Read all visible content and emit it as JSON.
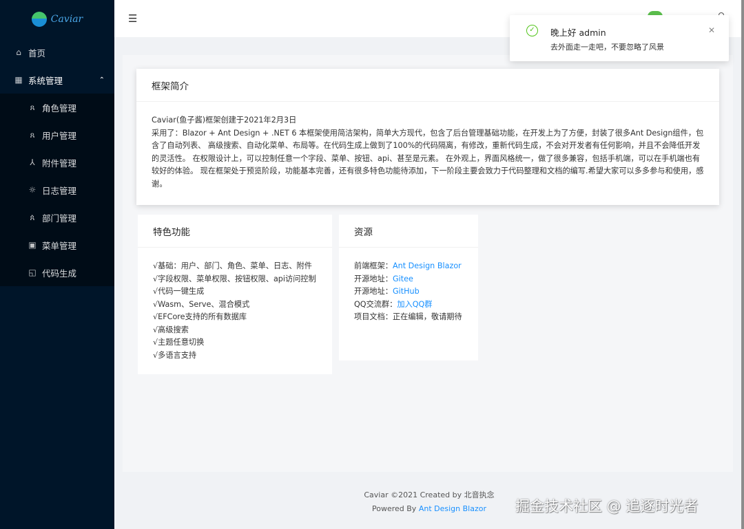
{
  "app": {
    "logo_text": "Caviar"
  },
  "sidebar": {
    "home": {
      "icon": "home-icon",
      "label": "首页"
    },
    "system": {
      "icon": "appstore-icon",
      "label": "系统管理"
    },
    "items": [
      {
        "icon": "user-icon",
        "label": "角色管理"
      },
      {
        "icon": "user-icon",
        "label": "用户管理"
      },
      {
        "icon": "cluster-icon",
        "label": "附件管理"
      },
      {
        "icon": "bug-icon",
        "label": "日志管理"
      },
      {
        "icon": "team-icon",
        "label": "部门管理"
      },
      {
        "icon": "menu-icon",
        "label": "菜单管理"
      },
      {
        "icon": "code-icon",
        "label": "代码生成"
      }
    ]
  },
  "header": {
    "fold_icon": "menu-fold-icon"
  },
  "intro": {
    "title": "框架简介",
    "line1": "Caviar(鱼子酱)框架创建于2021年2月3日",
    "para": "采用了：Blazor + Ant Design + .NET 6 本框架使用简洁架构，简单大方现代，包含了后台管理基础功能，在开发上为了方便，封装了很多Ant Design组件，包含了自动列表、 高级搜索、自动化菜单、布局等。在代码生成上做到了100%的代码隔离，有修改，重新代码生成，不会对开发者有任何影响，并且不会降低开发的灵活性。 在权限设计上，可以控制任意一个字段、菜单、按钮、api、甚至是元素。 在外观上，界面风格统一，做了很多兼容，包括手机端，可以在手机端也有较好的体验。 现在框架处于预览阶段，功能基本完善，还有很多特色功能待添加，下一阶段主要会致力于代码整理和文档的编写.希望大家可以多多参与和使用，感谢。"
  },
  "features": {
    "title": "特色功能",
    "items": [
      "√基础：用户、部门、角色、菜单、日志、附件",
      "√字段权限、菜单权限、按钮权限、api访问控制",
      "√代码一键生成",
      "√Wasm、Serve、混合模式",
      "√EFCore支持的所有数据库",
      "√高级搜索",
      "√主题任意切换",
      "√多语言支持"
    ]
  },
  "resources": {
    "title": "资源",
    "rows": [
      {
        "label": "前端框架：",
        "value": "Ant Design Blazor"
      },
      {
        "label": "开源地址：",
        "value": "Gitee"
      },
      {
        "label": "开源地址：",
        "value": "GitHub"
      },
      {
        "label": "QQ交流群：",
        "value": "加入QQ群"
      },
      {
        "label": "项目文档：",
        "value": "正在编辑，敬请期待"
      }
    ]
  },
  "footer": {
    "line1": "Caviar ©2021 Created by 北音执念",
    "powered_prefix": "Powered By ",
    "powered_link": "Ant Design Blazor"
  },
  "notification": {
    "icon": "check-circle-icon",
    "title": "晚上好 admin",
    "description": "去外面走一走吧，不要忽略了风景",
    "close_icon": "close-icon"
  },
  "watermark": "掘金技术社区 @ 追逐时光者",
  "colors": {
    "sidebar": "#001529",
    "submenu": "#000c17",
    "link": "#1890ff",
    "success": "#52c41a"
  }
}
